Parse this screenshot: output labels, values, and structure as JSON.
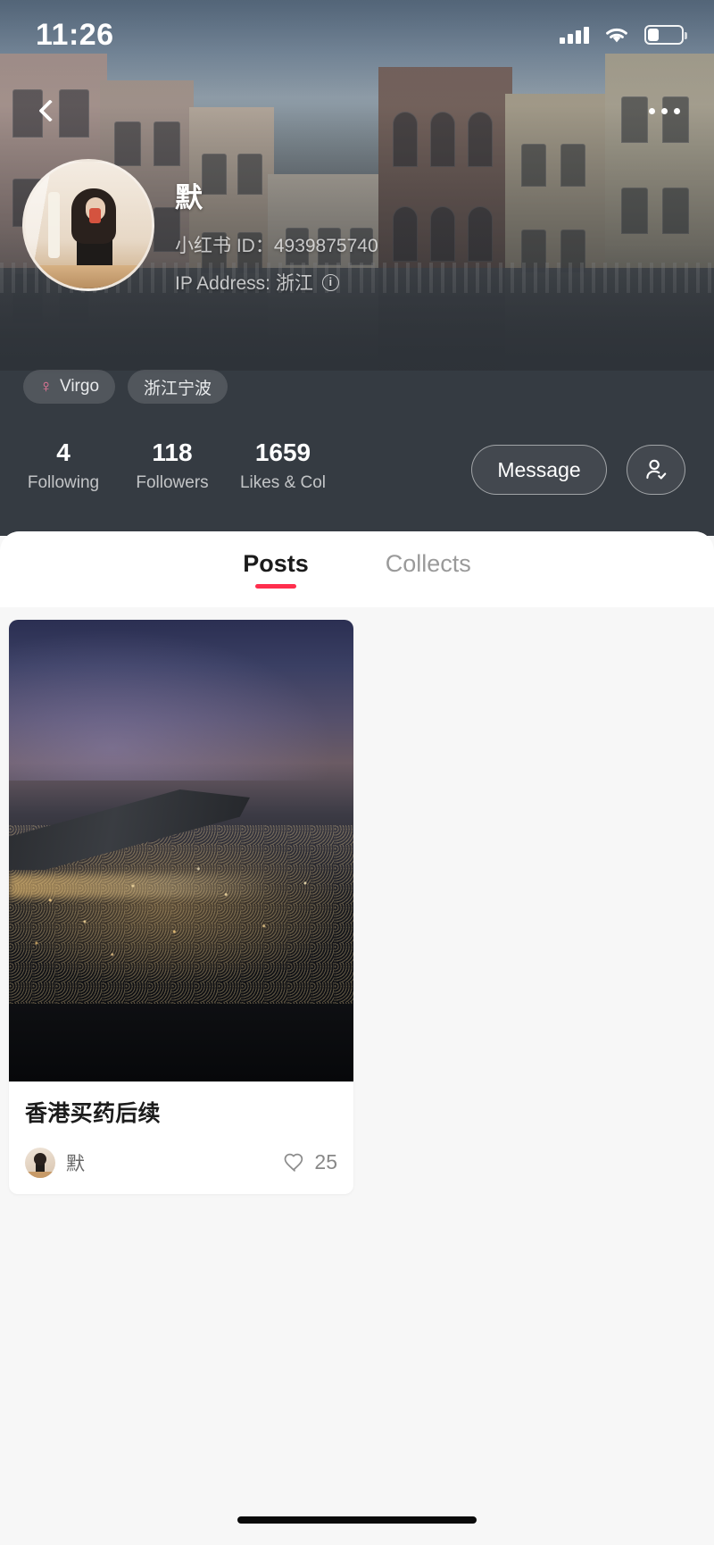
{
  "status_bar": {
    "time": "11:26",
    "signal_icon": "signal-bars-icon",
    "wifi_icon": "wifi-icon",
    "battery_icon": "battery-low-icon"
  },
  "top_nav": {
    "back_icon": "chevron-left-icon",
    "more_icon": "more-options-icon"
  },
  "profile": {
    "avatar_alt": "user-avatar",
    "username": "默",
    "user_id_label": "小红书 ID：4939875740",
    "ip_address_label": "IP Address: 浙江",
    "info_icon": "info-icon",
    "tags": [
      {
        "icon": "venus-symbol",
        "glyph": "♀",
        "label": "Virgo"
      },
      {
        "icon": "",
        "glyph": "",
        "label": "浙江宁波"
      }
    ],
    "stats": [
      {
        "value": "4",
        "label": "Following"
      },
      {
        "value": "118",
        "label": "Followers"
      },
      {
        "value": "1659",
        "label": "Likes & Col"
      }
    ],
    "message_button": "Message",
    "follow_icon": "person-check-icon"
  },
  "tabs": [
    {
      "label": "Posts",
      "active": true
    },
    {
      "label": "Collects",
      "active": false
    }
  ],
  "feed": {
    "posts": [
      {
        "image_alt": "airplane-wing-night-city-photo",
        "title": "香港买药后续",
        "author": "默",
        "author_avatar_alt": "post-author-avatar",
        "like_icon": "heart-outline-icon",
        "likes": "25"
      }
    ]
  },
  "colors": {
    "accent": "#ff2e4d",
    "header_bg": "#353b42",
    "page_bg": "#f7f7f7",
    "venus_pink": "#f2789c"
  },
  "home_indicator": "home-indicator-bar"
}
